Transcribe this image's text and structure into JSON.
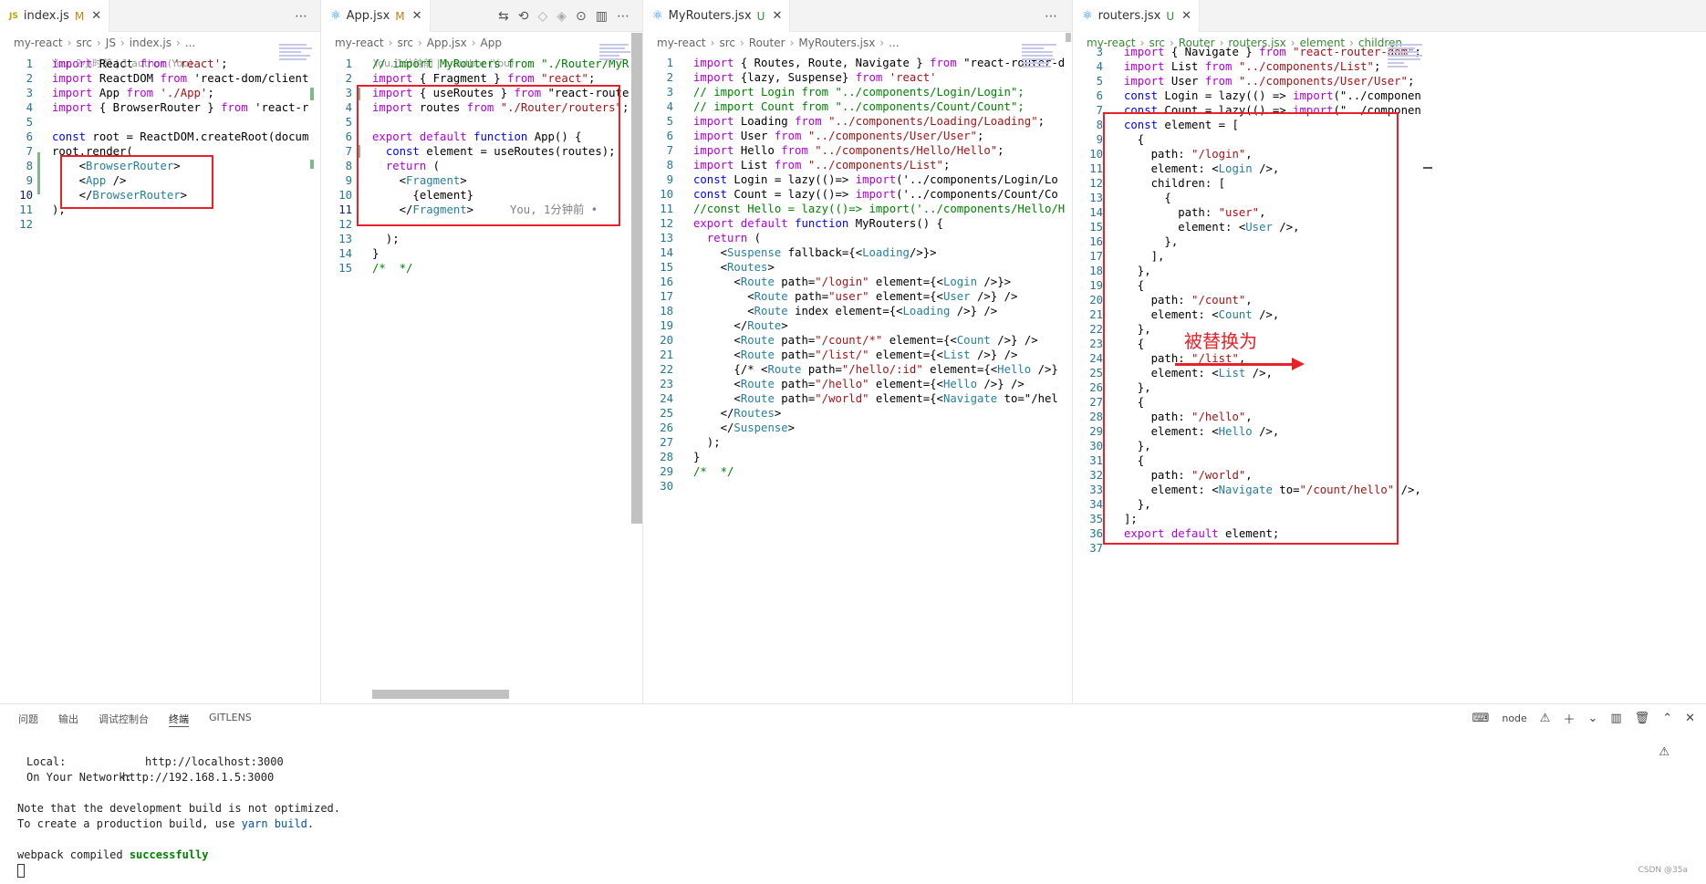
{
  "pane1": {
    "tab": {
      "icon": "JS",
      "name": "index.js",
      "status": "M"
    },
    "breadcrumb": [
      "my-react",
      "src",
      "JS",
      "index.js",
      "..."
    ],
    "blame": "You, 2小时前 | 1 author (You)",
    "lines": [
      {
        "n": "1",
        "t": "import React from 'react';"
      },
      {
        "n": "2",
        "t": "import ReactDOM from 'react-dom/client"
      },
      {
        "n": "3",
        "t": "import App from './App';"
      },
      {
        "n": "4",
        "t": "import { BrowserRouter } from 'react-r"
      },
      {
        "n": "5",
        "t": ""
      },
      {
        "n": "6",
        "t": "const root = ReactDOM.createRoot(docum"
      },
      {
        "n": "7",
        "t": "root.render("
      },
      {
        "n": "8",
        "t": "    <BrowserRouter>"
      },
      {
        "n": "9",
        "t": "    <App />"
      },
      {
        "n": "10",
        "t": "    </BrowserRouter>"
      },
      {
        "n": "11",
        "t": ");"
      },
      {
        "n": "12",
        "t": ""
      }
    ]
  },
  "pane2": {
    "tab": {
      "name": "App.jsx",
      "status": "M"
    },
    "breadcrumb": [
      "my-react",
      "src",
      "App.jsx",
      "App"
    ],
    "blame": "You, 1分钟前 | 1 author (You)",
    "inline_blame": "You, 1分钟前 •",
    "lines": [
      {
        "n": "1",
        "t": "// import MyRouters from \"./Router/MyR"
      },
      {
        "n": "2",
        "t": "import { Fragment } from \"react\";"
      },
      {
        "n": "3",
        "t": "import { useRoutes } from \"react-route"
      },
      {
        "n": "4",
        "t": "import routes from \"./Router/routers\";"
      },
      {
        "n": "5",
        "t": ""
      },
      {
        "n": "6",
        "t": "export default function App() {"
      },
      {
        "n": "7",
        "t": "  const element = useRoutes(routes);"
      },
      {
        "n": "8",
        "t": "  return ("
      },
      {
        "n": "9",
        "t": "    <Fragment>"
      },
      {
        "n": "10",
        "t": "      {element}"
      },
      {
        "n": "11",
        "t": "    </Fragment>"
      },
      {
        "n": "12",
        "t": ""
      },
      {
        "n": "13",
        "t": "  );"
      },
      {
        "n": "14",
        "t": "}"
      },
      {
        "n": "15",
        "t": "/*  */"
      }
    ]
  },
  "pane3": {
    "tab": {
      "name": "MyRouters.jsx",
      "status": "U"
    },
    "breadcrumb": [
      "my-react",
      "src",
      "Router",
      "MyRouters.jsx",
      "..."
    ],
    "lines": [
      {
        "n": "1",
        "t": "import { Routes, Route, Navigate } from \"react-router-d"
      },
      {
        "n": "2",
        "t": "import {lazy, Suspense} from 'react'"
      },
      {
        "n": "3",
        "t": "// import Login from \"../components/Login/Login\";"
      },
      {
        "n": "4",
        "t": "// import Count from \"../components/Count/Count\";"
      },
      {
        "n": "5",
        "t": "import Loading from \"../components/Loading/Loading\";"
      },
      {
        "n": "6",
        "t": "import User from \"../components/User/User\";"
      },
      {
        "n": "7",
        "t": "import Hello from \"../components/Hello/Hello\";"
      },
      {
        "n": "8",
        "t": "import List from \"../components/List\";"
      },
      {
        "n": "9",
        "t": "const Login = lazy(()=> import('../components/Login/Lo"
      },
      {
        "n": "10",
        "t": "const Count = lazy(()=> import('../components/Count/Co"
      },
      {
        "n": "11",
        "t": "//const Hello = lazy(()=> import('../components/Hello/H"
      },
      {
        "n": "12",
        "t": "export default function MyRouters() {"
      },
      {
        "n": "13",
        "t": "  return ("
      },
      {
        "n": "14",
        "t": "    <Suspense fallback={<Loading/>}>"
      },
      {
        "n": "15",
        "t": "    <Routes>"
      },
      {
        "n": "16",
        "t": "      <Route path=\"/login\" element={<Login />}>"
      },
      {
        "n": "17",
        "t": "        <Route path=\"user\" element={<User />} />"
      },
      {
        "n": "18",
        "t": "        <Route index element={<Loading />} />"
      },
      {
        "n": "19",
        "t": "      </Route>"
      },
      {
        "n": "20",
        "t": "      <Route path=\"/count/*\" element={<Count />} />"
      },
      {
        "n": "21",
        "t": "      <Route path=\"/list/\" element={<List />} />"
      },
      {
        "n": "22",
        "t": "      {/* <Route path=\"/hello/:id\" element={<Hello />}"
      },
      {
        "n": "23",
        "t": "      <Route path=\"/hello\" element={<Hello />} />"
      },
      {
        "n": "24",
        "t": "      <Route path=\"/world\" element={<Navigate to=\"/hel"
      },
      {
        "n": "25",
        "t": "    </Routes>"
      },
      {
        "n": "26",
        "t": "    </Suspense>"
      },
      {
        "n": "27",
        "t": "  );"
      },
      {
        "n": "28",
        "t": "}"
      },
      {
        "n": "29",
        "t": "/*  */"
      },
      {
        "n": "30",
        "t": ""
      }
    ]
  },
  "pane4": {
    "tab": {
      "name": "routers.jsx",
      "status": "U"
    },
    "breadcrumb": [
      "my-react",
      "src",
      "Router",
      "routers.jsx",
      "element",
      "children"
    ],
    "lines": [
      {
        "n": "3",
        "t": "import { Navigate } from \"react-router-dom\";"
      },
      {
        "n": "4",
        "t": "import List from \"../components/List\";"
      },
      {
        "n": "5",
        "t": "import User from \"../components/User/User\";"
      },
      {
        "n": "6",
        "t": "const Login = lazy(() => import(\"../componen"
      },
      {
        "n": "7",
        "t": "const Count = lazy(() => import(\"../componen"
      },
      {
        "n": "8",
        "t": "const element = ["
      },
      {
        "n": "9",
        "t": "  {"
      },
      {
        "n": "10",
        "t": "    path: \"/login\","
      },
      {
        "n": "11",
        "t": "    element: <Login />,"
      },
      {
        "n": "12",
        "t": "    children: ["
      },
      {
        "n": "13",
        "t": "      {"
      },
      {
        "n": "14",
        "t": "        path: \"user\","
      },
      {
        "n": "15",
        "t": "        element: <User />,"
      },
      {
        "n": "16",
        "t": "      },"
      },
      {
        "n": "17",
        "t": "    ],"
      },
      {
        "n": "18",
        "t": "  },"
      },
      {
        "n": "19",
        "t": "  {"
      },
      {
        "n": "20",
        "t": "    path: \"/count\","
      },
      {
        "n": "21",
        "t": "    element: <Count />,"
      },
      {
        "n": "22",
        "t": "  },"
      },
      {
        "n": "23",
        "t": "  {"
      },
      {
        "n": "24",
        "t": "    path: \"/list\","
      },
      {
        "n": "25",
        "t": "    element: <List />,"
      },
      {
        "n": "26",
        "t": "  },"
      },
      {
        "n": "27",
        "t": "  {"
      },
      {
        "n": "28",
        "t": "    path: \"/hello\","
      },
      {
        "n": "29",
        "t": "    element: <Hello />,"
      },
      {
        "n": "30",
        "t": "  },"
      },
      {
        "n": "31",
        "t": "  {"
      },
      {
        "n": "32",
        "t": "    path: \"/world\","
      },
      {
        "n": "33",
        "t": "    element: <Navigate to=\"/count/hello\" />,"
      },
      {
        "n": "34",
        "t": "  },"
      },
      {
        "n": "35",
        "t": "];"
      },
      {
        "n": "36",
        "t": "export default element;"
      },
      {
        "n": "37",
        "t": ""
      }
    ]
  },
  "annotation": {
    "text": "被替换为",
    "color": "#e8202a"
  },
  "panel": {
    "tabs": [
      "问题",
      "输出",
      "调试控制台",
      "终端",
      "GITLENS"
    ],
    "active_tab": "终端",
    "shell": "node",
    "terminal": {
      "local_label": "Local:",
      "local_url": "http://localhost:3000",
      "network_label": "On Your Network:",
      "network_url": "http://192.168.1.5:3000",
      "note1": "Note that the development build is not optimized.",
      "note2_pre": "To create a production build, use ",
      "note2_cmd": "yarn build",
      "note2_post": ".",
      "compiled_pre": "webpack compiled ",
      "compiled_status": "successfully"
    }
  },
  "watermark": "CSDN @35a",
  "icons": {
    "more": "more-actions-icon",
    "close": "close-icon",
    "warning": "warning-icon"
  }
}
